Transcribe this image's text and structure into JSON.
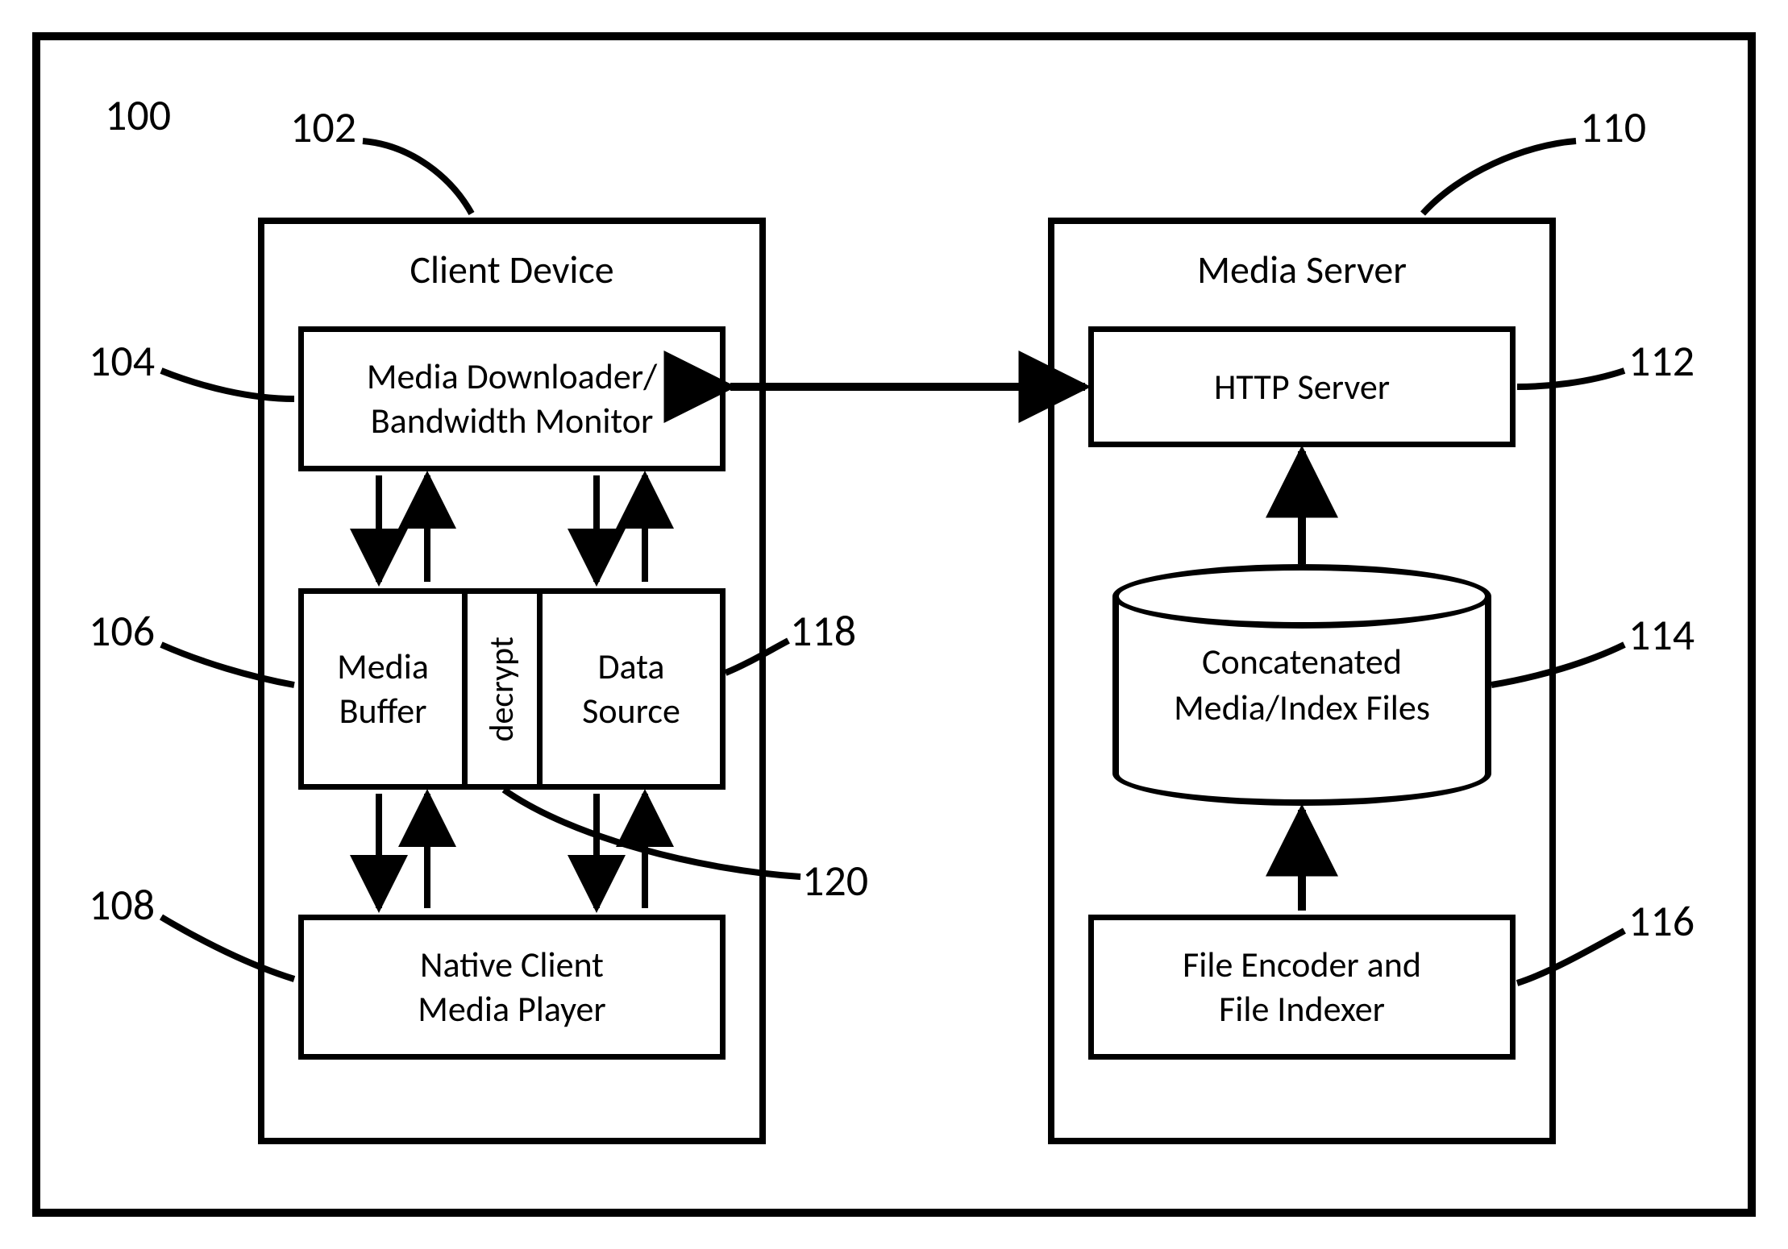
{
  "refs": {
    "system": "100",
    "client_device": "102",
    "media_downloader": "104",
    "media_buffer": "106",
    "native_player": "108",
    "media_server": "110",
    "http_server": "112",
    "concat_files": "114",
    "file_encoder": "116",
    "data_source": "118",
    "decrypt": "120"
  },
  "labels": {
    "client_device": "Client Device",
    "media_server": "Media Server",
    "media_downloader": "Media Downloader/\nBandwidth Monitor",
    "media_buffer": "Media\nBuffer",
    "decrypt": "decrypt",
    "data_source": "Data\nSource",
    "native_player": "Native Client\nMedia Player",
    "http_server": "HTTP Server",
    "concat_files": "Concatenated\nMedia/Index Files",
    "file_encoder": "File Encoder and\nFile Indexer"
  }
}
